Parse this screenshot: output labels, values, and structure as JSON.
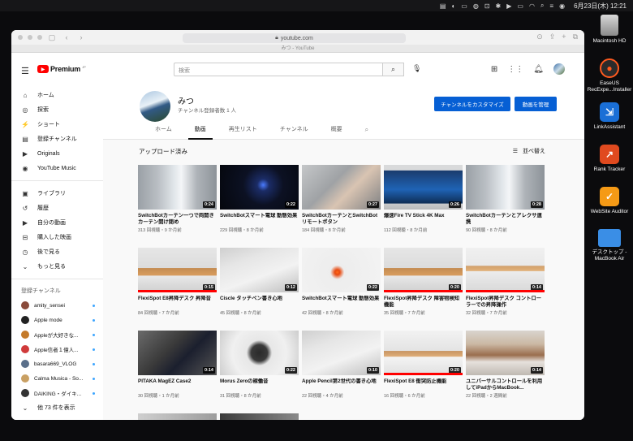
{
  "menubar": {
    "clock": "6月23日(木) 12:21"
  },
  "desktop": {
    "icons": [
      {
        "label": "Macintosh HD",
        "icon": "hard-drive-icon"
      },
      {
        "label": "EaseUS RecExpe...Installer",
        "icon": "easeus-icon"
      },
      {
        "label": "LinkAssistant",
        "icon": "linkassistant-icon"
      },
      {
        "label": "Rank Tracker",
        "icon": "rank-tracker-icon"
      },
      {
        "label": "WebSite Auditor",
        "icon": "website-auditor-icon"
      },
      {
        "label": "デスクトップ - MacBook Air",
        "icon": "folder-icon"
      }
    ]
  },
  "browser": {
    "url": "youtube.com",
    "tab_title": "みつ - YouTube"
  },
  "header": {
    "logo_text": "Premium",
    "logo_sup": "JP",
    "search_placeholder": "検索"
  },
  "sidebar": {
    "main": [
      {
        "label": "ホーム",
        "icon": "home-icon",
        "glyph": "⌂"
      },
      {
        "label": "探索",
        "icon": "compass-icon",
        "glyph": "◎"
      },
      {
        "label": "ショート",
        "icon": "shorts-icon",
        "glyph": "⚡"
      },
      {
        "label": "登録チャンネル",
        "icon": "subscriptions-icon",
        "glyph": "▤"
      },
      {
        "label": "Originals",
        "icon": "originals-icon",
        "glyph": "▶"
      },
      {
        "label": "YouTube Music",
        "icon": "music-icon",
        "glyph": "◉"
      }
    ],
    "library": [
      {
        "label": "ライブラリ",
        "icon": "library-icon",
        "glyph": "▣"
      },
      {
        "label": "履歴",
        "icon": "history-icon",
        "glyph": "↺"
      },
      {
        "label": "自分の動画",
        "icon": "your-videos-icon",
        "glyph": "▶"
      },
      {
        "label": "購入した映画",
        "icon": "purchases-icon",
        "glyph": "⊟"
      },
      {
        "label": "後で見る",
        "icon": "watch-later-icon",
        "glyph": "◷"
      },
      {
        "label": "もっと見る",
        "icon": "chevron-down-icon",
        "glyph": "⌄"
      }
    ],
    "subs_heading": "登録チャンネル",
    "subs": [
      {
        "label": "amity_sensei",
        "color": "#8a4b3b"
      },
      {
        "label": "Apple mode",
        "color": "#222222"
      },
      {
        "label": "Appleが大好きな...",
        "color": "#c47a2a"
      },
      {
        "label": "Apple信者１億人...",
        "color": "#d03b3b"
      },
      {
        "label": "basara669_VLOG",
        "color": "#5a6f8a"
      },
      {
        "label": "Calma Musica - So...",
        "color": "#c9a063"
      },
      {
        "label": "DAIKING・ダイキ...",
        "color": "#333333"
      }
    ],
    "more_subs": "他 73 件を表示"
  },
  "channel": {
    "name": "みつ",
    "subscribers": "チャンネル登録者数 1 人",
    "customize_label": "チャンネルをカスタマイズ",
    "manage_label": "動画を管理",
    "tabs": [
      "ホーム",
      "動画",
      "再生リスト",
      "チャンネル",
      "概要"
    ],
    "active_tab": "動画"
  },
  "section": {
    "title": "アップロード済み",
    "sort_label": "並べ替え"
  },
  "videos": [
    {
      "title": "SwitchBotカーテン一つで両開きカーテン開け閉め",
      "meta": "313 回視聴・9 か月前",
      "duration": "0:24",
      "progress": 0.0,
      "scene": "curtain"
    },
    {
      "title": "SwitchBotスマート電球 動態効果",
      "meta": "229 回視聴・8 か月前",
      "duration": "0:22",
      "progress": 0.0,
      "scene": "dark-blue"
    },
    {
      "title": "SwitchBotカーテンとSwitchBotリモートボタン",
      "meta": "184 回視聴・8 か月前",
      "duration": "0:27",
      "progress": 0.0,
      "scene": "hand-remote"
    },
    {
      "title": "爆速Fire TV Stick 4K Max",
      "meta": "112 回視聴・8 か月前",
      "duration": "0:26",
      "progress": 0.0,
      "scene": "tv-prime"
    },
    {
      "title": "SwitchBotカーテンとアレクサ連携",
      "meta": "90 回視聴・8 か月前",
      "duration": "0:28",
      "progress": 0.0,
      "scene": "curtain"
    },
    {
      "title": "FlexiSpot E8昇降デスク 昇降音",
      "meta": "84 回視聴・7 か月前",
      "duration": "0:15",
      "progress": 1.0,
      "scene": "desk"
    },
    {
      "title": "Ciscle タッチペン書き心地",
      "meta": "45 回視聴・8 か月前",
      "duration": "0:12",
      "progress": 0.0,
      "scene": "tablet"
    },
    {
      "title": "SwitchBotスマート電球 動態効果",
      "meta": "42 回視聴・8 か月前",
      "duration": "0:22",
      "progress": 0.0,
      "scene": "wall-bulb"
    },
    {
      "title": "FlexiSpot昇降デスク 障害物検知機能",
      "meta": "35 回視聴・7 か月前",
      "duration": "0:20",
      "progress": 1.0,
      "scene": "desk"
    },
    {
      "title": "FlexiSpot昇降デスク コントローラーでの昇降操作",
      "meta": "32 回視聴・7 か月前",
      "duration": "0:14",
      "progress": 1.0,
      "scene": "room-desk"
    },
    {
      "title": "PITAKA MagEZ Case2",
      "meta": "30 回視聴・1 か月前",
      "duration": "0:14",
      "progress": 0.0,
      "scene": "ipad-case"
    },
    {
      "title": "Morus Zeroの稼働音",
      "meta": "31 回視聴・8 か月前",
      "duration": "0:22",
      "progress": 0.0,
      "scene": "dryer"
    },
    {
      "title": "Apple Pencil第2世代の書き心地",
      "meta": "22 回視聴・4 か月前",
      "duration": "0:10",
      "progress": 0.0,
      "scene": "tablet"
    },
    {
      "title": "FlexiSpot E8 衝突防止機能",
      "meta": "16 回視聴・6 か月前",
      "duration": "0:20",
      "progress": 1.0,
      "scene": "desk-white"
    },
    {
      "title": "ユニバーサルコントロールを利用してiPadからMacBook...",
      "meta": "22 回視聴・2 週間前",
      "duration": "0:14",
      "progress": 0.0,
      "scene": "macbook"
    }
  ]
}
